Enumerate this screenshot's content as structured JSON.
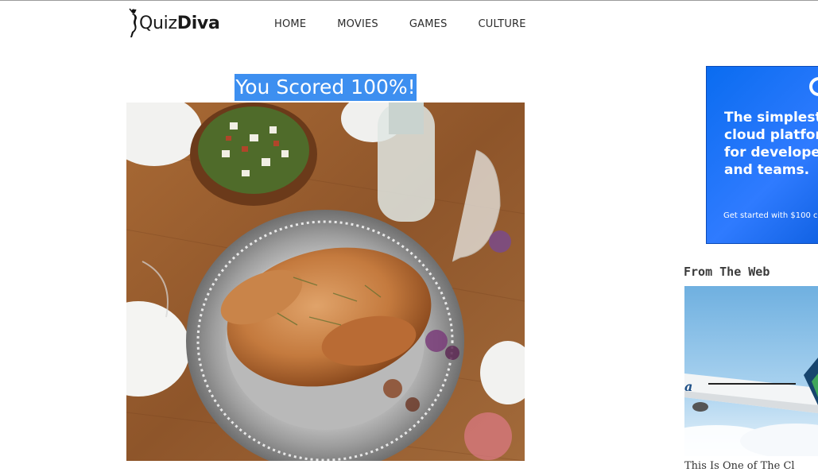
{
  "brand": {
    "name_prefix": "Quiz",
    "name_bold": "Diva"
  },
  "nav": {
    "items": [
      "HOME",
      "MOVIES",
      "GAMES",
      "CULTURE"
    ]
  },
  "result": {
    "headline": "You Scored 100%!"
  },
  "hero": {
    "image_subject": "roast turkey on silver platter with salad bowl and wine glasses on wooden table"
  },
  "ad": {
    "headline": "The simplest\ncloud platform\nfor developers\nand teams.",
    "cta": "Get started with $100 c",
    "colors": {
      "background": "#1f6ff5",
      "text": "#ffffff"
    }
  },
  "sidebar": {
    "section_title": "From The Web",
    "card": {
      "image_subject": "airplane flying over clouds",
      "caption": "This Is One of The Cl"
    }
  },
  "colors": {
    "highlight": "#3d8ff0",
    "text": "#2b2b2b"
  }
}
